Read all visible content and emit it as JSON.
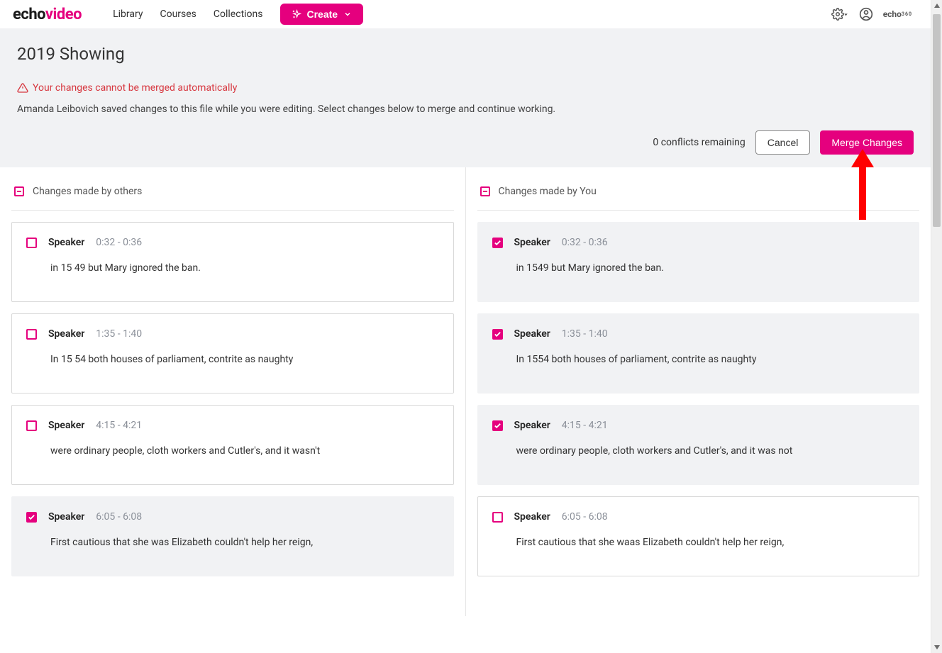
{
  "brand": {
    "part1": "echo",
    "part2": "video",
    "small_logo_top": "echo",
    "small_logo_bottom": "360"
  },
  "nav": {
    "library": "Library",
    "courses": "Courses",
    "collections": "Collections",
    "create": "Create"
  },
  "page": {
    "title": "2019 Showing",
    "alert": "Your changes cannot be merged automatically",
    "help": "Amanda Leibovich saved changes to this file while you were editing. Select changes below to merge and continue working.",
    "conflicts_remaining": "0 conflicts remaining",
    "cancel": "Cancel",
    "merge": "Merge Changes"
  },
  "columns": {
    "others_header": "Changes made by others",
    "you_header": "Changes made by You",
    "speaker_label": "Speaker"
  },
  "others": [
    {
      "checked": false,
      "time": "0:32 - 0:36",
      "text": "in 15 49 but Mary ignored the ban."
    },
    {
      "checked": false,
      "time": "1:35 - 1:40",
      "text": "In 15 54 both houses of parliament, contrite as naughty"
    },
    {
      "checked": false,
      "time": "4:15 - 4:21",
      "text": "were ordinary people, cloth workers and Cutler's, and it wasn't"
    },
    {
      "checked": true,
      "time": "6:05 - 6:08",
      "text": "First cautious that she was Elizabeth couldn't help her reign,"
    }
  ],
  "you": [
    {
      "checked": true,
      "time": "0:32 - 0:36",
      "text": "in 1549 but Mary ignored the ban."
    },
    {
      "checked": true,
      "time": "1:35 - 1:40",
      "text": "In 1554 both houses of parliament, contrite as naughty"
    },
    {
      "checked": true,
      "time": "4:15 - 4:21",
      "text": "were ordinary people, cloth workers and Cutler's, and it was not"
    },
    {
      "checked": false,
      "time": "6:05 - 6:08",
      "text": "First cautious that she waas Elizabeth couldn't help her reign,"
    }
  ]
}
